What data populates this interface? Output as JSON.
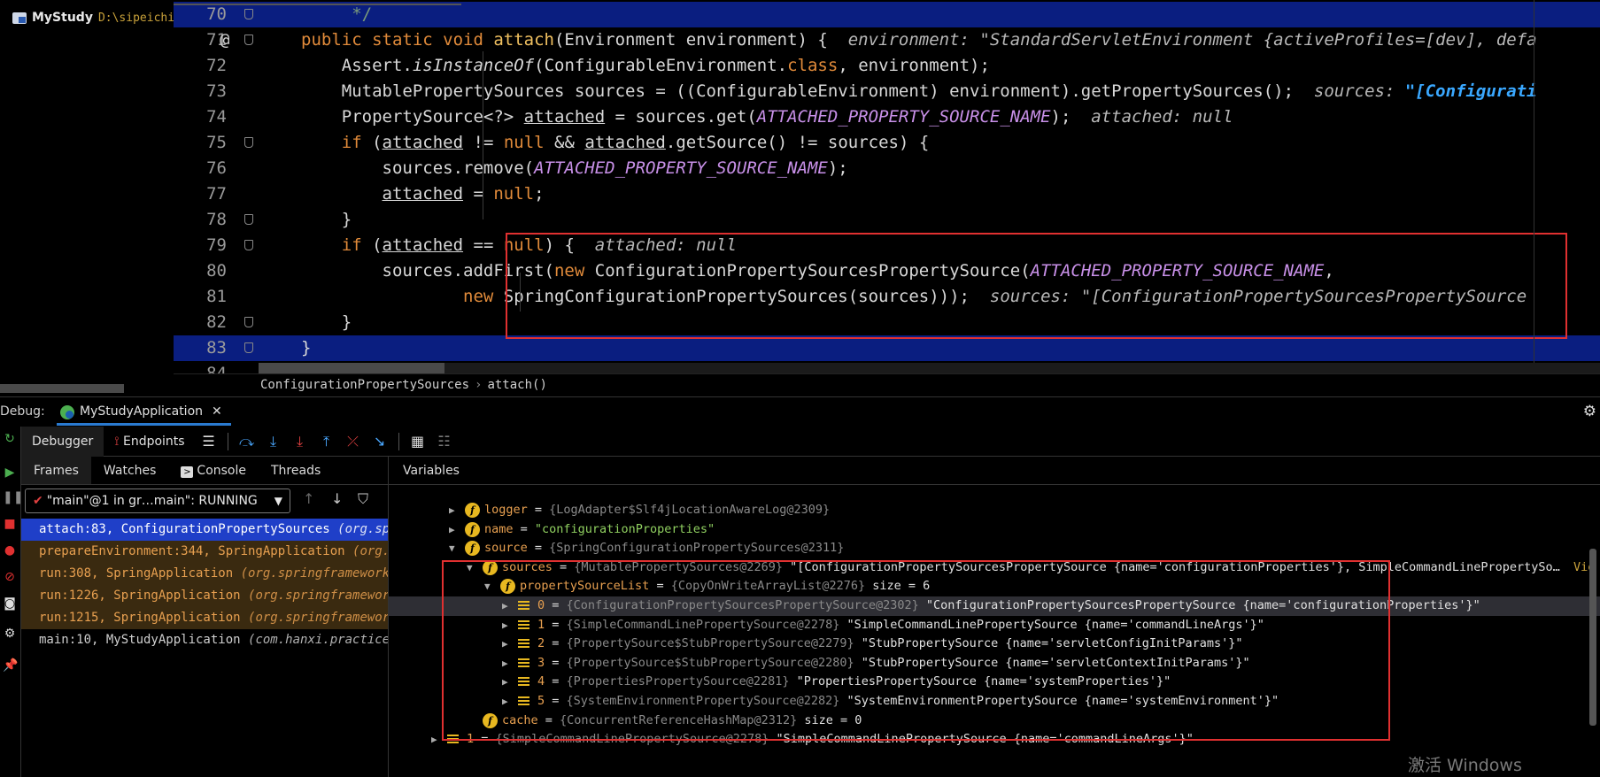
{
  "project": {
    "name": "MyStudy",
    "path": "D:\\sipeichi"
  },
  "editor": {
    "lines": [
      {
        "num": "70",
        "tokens": [
          {
            "t": "     */",
            "c": "cmt"
          }
        ],
        "highlight": true,
        "fold": true
      },
      {
        "num": "71",
        "at": "@",
        "tokens": [
          {
            "t": "public static void ",
            "c": "kw"
          },
          {
            "t": "attach",
            "c": "fn"
          },
          {
            "t": "(Environment environment) {  ",
            "c": ""
          },
          {
            "t": "environment: \"StandardServletEnvironment {activeProfiles=[dev], defa",
            "c": "hint"
          }
        ],
        "fold": true
      },
      {
        "num": "72",
        "tokens": [
          {
            "t": "    Assert.",
            "c": ""
          },
          {
            "t": "isInstanceOf",
            "c": "itl"
          },
          {
            "t": "(ConfigurableEnvironment.",
            "c": ""
          },
          {
            "t": "class",
            "c": "kw"
          },
          {
            "t": ", environment);",
            "c": ""
          }
        ]
      },
      {
        "num": "73",
        "tokens": [
          {
            "t": "    MutablePropertySources sources = ((ConfigurableEnvironment) environment).getPropertySources();  ",
            "c": ""
          },
          {
            "t": "sources: ",
            "c": "hint"
          },
          {
            "t": "\"[Configurati",
            "c": "hint-blue"
          }
        ]
      },
      {
        "num": "74",
        "tokens": [
          {
            "t": "    PropertySource<?> ",
            "c": ""
          },
          {
            "t": "attached",
            "c": "ul"
          },
          {
            "t": " = sources.get(",
            "c": ""
          },
          {
            "t": "ATTACHED_PROPERTY_SOURCE_NAME",
            "c": "cst"
          },
          {
            "t": ");  ",
            "c": ""
          },
          {
            "t": "attached: null",
            "c": "hint"
          }
        ]
      },
      {
        "num": "75",
        "tokens": [
          {
            "t": "    ",
            "c": ""
          },
          {
            "t": "if",
            "c": "kw"
          },
          {
            "t": " (",
            "c": ""
          },
          {
            "t": "attached",
            "c": "ul"
          },
          {
            "t": " != ",
            "c": ""
          },
          {
            "t": "null",
            "c": "kw"
          },
          {
            "t": " && ",
            "c": ""
          },
          {
            "t": "attached",
            "c": "ul"
          },
          {
            "t": ".getSource() != sources) {",
            "c": ""
          }
        ],
        "fold": true
      },
      {
        "num": "76",
        "tokens": [
          {
            "t": "        sources.remove(",
            "c": ""
          },
          {
            "t": "ATTACHED_PROPERTY_SOURCE_NAME",
            "c": "cst"
          },
          {
            "t": ");",
            "c": ""
          }
        ]
      },
      {
        "num": "77",
        "tokens": [
          {
            "t": "        ",
            "c": ""
          },
          {
            "t": "attached",
            "c": "ul"
          },
          {
            "t": " = ",
            "c": ""
          },
          {
            "t": "null",
            "c": "kw"
          },
          {
            "t": ";",
            "c": ""
          }
        ]
      },
      {
        "num": "78",
        "tokens": [
          {
            "t": "    }",
            "c": ""
          }
        ],
        "fold": true
      },
      {
        "num": "79",
        "tokens": [
          {
            "t": "    ",
            "c": ""
          },
          {
            "t": "if",
            "c": "kw"
          },
          {
            "t": " (",
            "c": ""
          },
          {
            "t": "attached",
            "c": "ul"
          },
          {
            "t": " == ",
            "c": ""
          },
          {
            "t": "null",
            "c": "kw"
          },
          {
            "t": ") {  ",
            "c": ""
          },
          {
            "t": "attached: null",
            "c": "hint"
          }
        ],
        "fold": true
      },
      {
        "num": "80",
        "tokens": [
          {
            "t": "        sources.addFirst(",
            "c": ""
          },
          {
            "t": "new",
            "c": "kw"
          },
          {
            "t": " ConfigurationPropertySourcesPropertySource(",
            "c": ""
          },
          {
            "t": "ATTACHED_PROPERTY_SOURCE_NAME",
            "c": "cst"
          },
          {
            "t": ",",
            "c": ""
          }
        ]
      },
      {
        "num": "81",
        "tokens": [
          {
            "t": "                ",
            "c": ""
          },
          {
            "t": "new",
            "c": "kw"
          },
          {
            "t": " SpringConfigurationPropertySources(sources)));  ",
            "c": ""
          },
          {
            "t": "sources: \"[ConfigurationPropertySourcesPropertySource ",
            "c": "hint"
          }
        ]
      },
      {
        "num": "82",
        "tokens": [
          {
            "t": "    }",
            "c": ""
          }
        ],
        "fold": true
      },
      {
        "num": "83",
        "tokens": [
          {
            "t": "}",
            "c": ""
          }
        ],
        "highlight": true,
        "fold": true
      },
      {
        "num": "84",
        "tokens": [
          {
            "t": "",
            "c": ""
          }
        ]
      }
    ]
  },
  "breadcrumb": {
    "class_name": "ConfigurationPropertySources",
    "method": "attach()"
  },
  "debug": {
    "label": "Debug:",
    "session_tab": "MyStudyApplication",
    "toolbar": {
      "debugger": "Debugger",
      "endpoints": "Endpoints"
    },
    "frames_tabs": [
      "Frames",
      "Watches",
      "Console",
      "Threads"
    ],
    "thread": "\"main\"@1 in gr…main\": RUNNING",
    "frames": [
      {
        "method": "attach:83, ConfigurationPropertySources ",
        "pkg": "(org.spri",
        "style": "sel"
      },
      {
        "method": "prepareEnvironment:344, SpringApplication ",
        "pkg": "(org.sp",
        "style": "lib"
      },
      {
        "method": "run:308, SpringApplication ",
        "pkg": "(org.springframework.b",
        "style": "lib"
      },
      {
        "method": "run:1226, SpringApplication ",
        "pkg": "(org.springframework.",
        "style": "lib"
      },
      {
        "method": "run:1215, SpringApplication ",
        "pkg": "(org.springframework.",
        "style": "lib"
      },
      {
        "method": "main:10, MyStudyApplication ",
        "pkg": "(com.hanxi.practice)",
        "style": "plain"
      }
    ],
    "variables_header": "Variables",
    "variables": [
      {
        "indent": 0,
        "icon": "f",
        "name": "logger",
        "ref": "{LogAdapter$Slf4jLocationAwareLog@2309}",
        "val": "",
        "str": ""
      },
      {
        "indent": 0,
        "icon": "f",
        "name": "name",
        "ref": "",
        "val": "",
        "str": "\"configurationProperties\""
      },
      {
        "indent": 0,
        "icon": "f",
        "name": "source",
        "ref": "{SpringConfigurationPropertySources@2311}",
        "val": "",
        "str": "",
        "open": true
      },
      {
        "indent": 1,
        "icon": "f",
        "name": "sources",
        "ref": "{MutablePropertySources@2269}",
        "val": " \"[ConfigurationPropertySourcesPropertySource {name='configurationProperties'}, SimpleCommandLinePropertySo…",
        "str": "",
        "tail": "Vie",
        "open": true
      },
      {
        "indent": 2,
        "icon": "f",
        "name": "propertySourceList",
        "ref": "{CopyOnWriteArrayList@2276}",
        "val": "  size = 6",
        "str": "",
        "open": true
      },
      {
        "indent": 3,
        "icon": "l",
        "name": "0",
        "ref": "{ConfigurationPropertySourcesPropertySource@2302}",
        "val": " \"ConfigurationPropertySourcesPropertySource {name='configurationProperties'}\"",
        "str": "",
        "sel": true
      },
      {
        "indent": 3,
        "icon": "l",
        "name": "1",
        "ref": "{SimpleCommandLinePropertySource@2278}",
        "val": " \"SimpleCommandLinePropertySource {name='commandLineArgs'}\"",
        "str": ""
      },
      {
        "indent": 3,
        "icon": "l",
        "name": "2",
        "ref": "{PropertySource$StubPropertySource@2279}",
        "val": " \"StubPropertySource {name='servletConfigInitParams'}\"",
        "str": ""
      },
      {
        "indent": 3,
        "icon": "l",
        "name": "3",
        "ref": "{PropertySource$StubPropertySource@2280}",
        "val": " \"StubPropertySource {name='servletContextInitParams'}\"",
        "str": ""
      },
      {
        "indent": 3,
        "icon": "l",
        "name": "4",
        "ref": "{PropertiesPropertySource@2281}",
        "val": " \"PropertiesPropertySource {name='systemProperties'}\"",
        "str": ""
      },
      {
        "indent": 3,
        "icon": "l",
        "name": "5",
        "ref": "{SystemEnvironmentPropertySource@2282}",
        "val": " \"SystemEnvironmentPropertySource {name='systemEnvironment'}\"",
        "str": ""
      },
      {
        "indent": 1,
        "icon": "f",
        "name": "cache",
        "ref": "{ConcurrentReferenceHashMap@2312}",
        "val": "  size = 0",
        "str": "",
        "noarrow": true
      },
      {
        "indent": -1,
        "icon": "l",
        "name": "1",
        "ref": "{SimpleCommandLinePropertySource@2278}",
        "val": " \"SimpleCommandLinePropertySource {name='commandLineArgs'}\"",
        "str": ""
      }
    ]
  },
  "watermark": "激活 Windows",
  "colors": {
    "selection": "#1f3fc8",
    "highlight_line": "#0a1e80",
    "callout_border": "#e03030",
    "field_icon": "#e8b820"
  }
}
